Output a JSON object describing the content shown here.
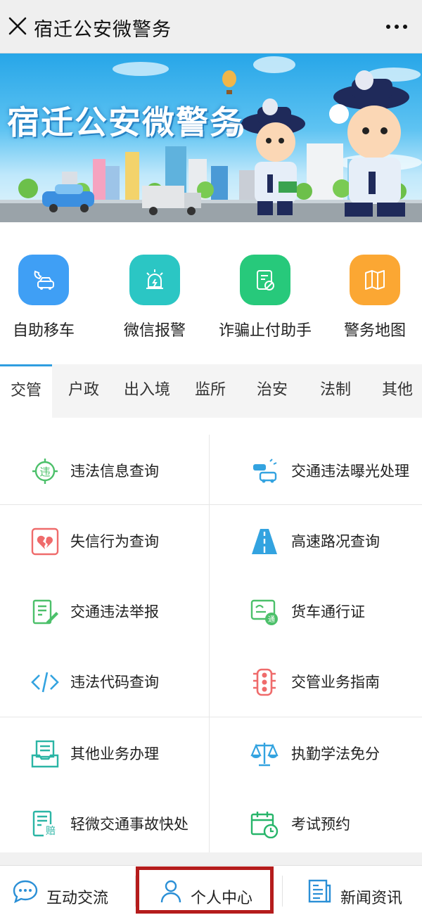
{
  "window": {
    "title": "宿迁公安微警务",
    "close_icon": "close-icon",
    "more_icon": "more-dots-icon"
  },
  "banner": {
    "title": "宿迁公安微警务"
  },
  "quick_actions": [
    {
      "label": "自助移车",
      "icon": "car-phone-icon",
      "color": "#3f9ff5"
    },
    {
      "label": "微信报警",
      "icon": "alarm-light-icon",
      "color": "#2bc6c4"
    },
    {
      "label": "诈骗止付助手",
      "icon": "fraud-stop-icon",
      "color": "#27c97b"
    },
    {
      "label": "警务地图",
      "icon": "map-icon",
      "color": "#fba733"
    }
  ],
  "tabs": [
    "交管",
    "户政",
    "出入境",
    "监所",
    "治安",
    "法制",
    "其他"
  ],
  "active_tab": "交管",
  "services": [
    {
      "label": "违法信息查询",
      "icon": "violation-query-icon"
    },
    {
      "label": "交通违法曝光处理",
      "icon": "traffic-exposure-icon"
    },
    {
      "label": "失信行为查询",
      "icon": "broken-heart-icon"
    },
    {
      "label": "高速路况查询",
      "icon": "highway-icon"
    },
    {
      "label": "交通违法举报",
      "icon": "report-icon"
    },
    {
      "label": "货车通行证",
      "icon": "truck-pass-icon"
    },
    {
      "label": "违法代码查询",
      "icon": "code-icon"
    },
    {
      "label": "交管业务指南",
      "icon": "traffic-light-icon"
    },
    {
      "label": "其他业务办理",
      "icon": "inbox-icon"
    },
    {
      "label": "执勤学法免分",
      "icon": "scales-icon"
    },
    {
      "label": "轻微交通事故快处",
      "icon": "compensation-icon"
    },
    {
      "label": "考试预约",
      "icon": "calendar-clock-icon"
    }
  ],
  "bottom_nav": [
    {
      "label": "互动交流",
      "icon": "chat-icon"
    },
    {
      "label": "个人中心",
      "icon": "person-icon"
    },
    {
      "label": "新闻资讯",
      "icon": "news-icon"
    }
  ],
  "colors": {
    "accent_tab": "#2f9ee0",
    "highlight_box": "#b51c1c",
    "green_icon": "#4cc06a",
    "blue_icon": "#33a3e0",
    "red_icon": "#ef6b6b"
  }
}
